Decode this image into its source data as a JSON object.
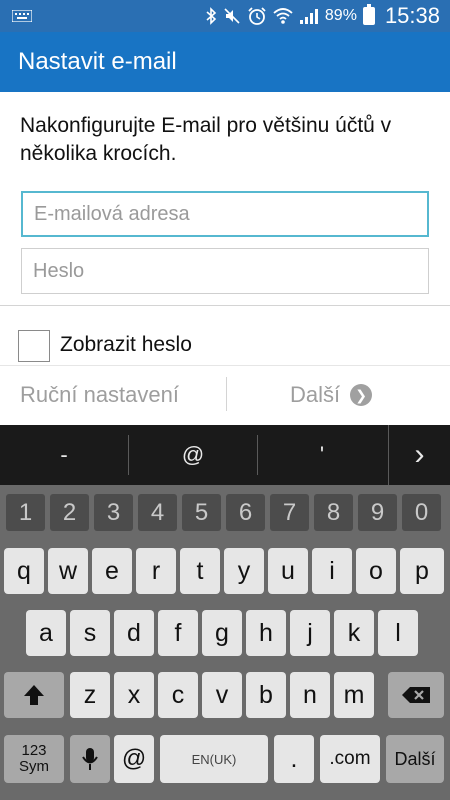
{
  "status_bar": {
    "battery": "89%",
    "time": "15:38"
  },
  "app_bar": {
    "title": "Nastavit e-mail"
  },
  "form": {
    "description": "Nakonfigurujte E-mail pro většinu účtů v několika krocích.",
    "email_placeholder": "E-mailová adresa",
    "email_value": "",
    "password_placeholder": "Heslo",
    "password_value": "",
    "show_password_label": "Zobrazit heslo",
    "show_password_checked": false,
    "manual_setup_label": "Ruční nastavení",
    "next_label": "Další"
  },
  "suggestions": [
    "-",
    "@",
    "'"
  ],
  "keyboard": {
    "number_row": [
      "1",
      "2",
      "3",
      "4",
      "5",
      "6",
      "7",
      "8",
      "9",
      "0"
    ],
    "row1": [
      "q",
      "w",
      "e",
      "r",
      "t",
      "y",
      "u",
      "i",
      "o",
      "p"
    ],
    "row2": [
      "a",
      "s",
      "d",
      "f",
      "g",
      "h",
      "j",
      "k",
      "l"
    ],
    "row3": [
      "z",
      "x",
      "c",
      "v",
      "b",
      "n",
      "m"
    ],
    "sym_label_top": "123",
    "sym_label_bottom": "Sym",
    "at_key": "@",
    "space_label": "EN(UK)",
    "period_key": ".",
    "com_key": ".com",
    "enter_label": "Další"
  }
}
